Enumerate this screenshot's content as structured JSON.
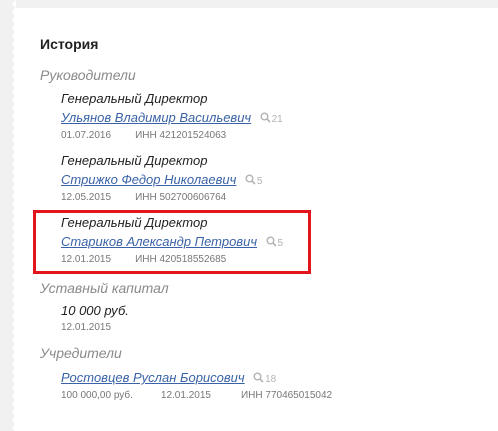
{
  "history": {
    "title": "История",
    "directors_heading": "Руководители",
    "directors": [
      {
        "role": "Генеральный Директор",
        "name": "Ульянов Владимир Васильевич",
        "count": "21",
        "date": "01.07.2016",
        "inn": "ИНН 421201524063"
      },
      {
        "role": "Генеральный Директор",
        "name": "Стрижко Федор Николаевич",
        "count": "5",
        "date": "12.05.2015",
        "inn": "ИНН 502700606764"
      },
      {
        "role": "Генеральный Директор",
        "name": "Стариков Александр Петрович",
        "count": "5",
        "date": "12.01.2015",
        "inn": "ИНН 420518552685"
      }
    ],
    "capital_heading": "Уставный капитал",
    "capital": {
      "amount": "10 000 руб.",
      "date": "12.01.2015"
    },
    "founders_heading": "Учредители",
    "founders": [
      {
        "name": "Ростовцев Руслан Борисович",
        "count": "18",
        "share": "100 000,00 руб.",
        "date": "12.01.2015",
        "inn": "ИНН 770465015042"
      }
    ]
  },
  "colors": {
    "link": "#3a63a7",
    "highlight": "#e2151b",
    "muted": "#8a8a8a"
  },
  "icons": {
    "search": "search-icon"
  }
}
